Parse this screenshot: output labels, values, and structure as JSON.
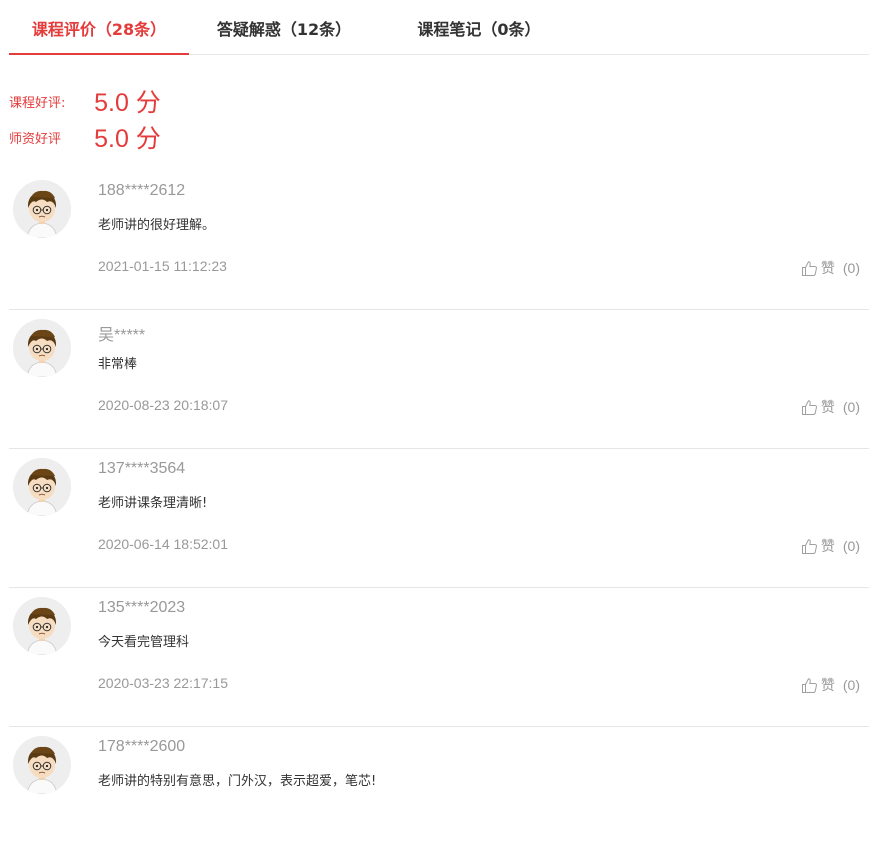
{
  "tabs": [
    {
      "label": "课程评价（28条）",
      "active": true
    },
    {
      "label": "答疑解惑（12条）",
      "active": false
    },
    {
      "label": "课程笔记（0条）",
      "active": false
    }
  ],
  "ratings": [
    {
      "label": "课程好评:",
      "value": "5.0 分"
    },
    {
      "label": "师资好评",
      "value": "5.0 分"
    }
  ],
  "reviews": [
    {
      "user": "188****2612",
      "content": "老师讲的很好理解。",
      "time": "2021-01-15 11:12:23",
      "like_label": "赞",
      "like_count": "(0)"
    },
    {
      "user": "吴*****",
      "content": "非常棒",
      "time": "2020-08-23 20:18:07",
      "like_label": "赞",
      "like_count": "(0)"
    },
    {
      "user": "137****3564",
      "content": "老师讲课条理清晰!",
      "time": "2020-06-14 18:52:01",
      "like_label": "赞",
      "like_count": "(0)"
    },
    {
      "user": "135****2023",
      "content": "今天看完管理科",
      "time": "2020-03-23 22:17:15",
      "like_label": "赞",
      "like_count": "(0)"
    },
    {
      "user": "178****2600",
      "content": "老师讲的特别有意思，门外汉，表示超爱，笔芯!",
      "time": "",
      "like_label": "",
      "like_count": ""
    }
  ],
  "colors": {
    "accent": "#e43b3b",
    "muted": "#999999",
    "divider": "#e6e6e6"
  },
  "icons": {
    "like": "thumbs-up-icon",
    "avatar": "cartoon-boy-avatar"
  }
}
